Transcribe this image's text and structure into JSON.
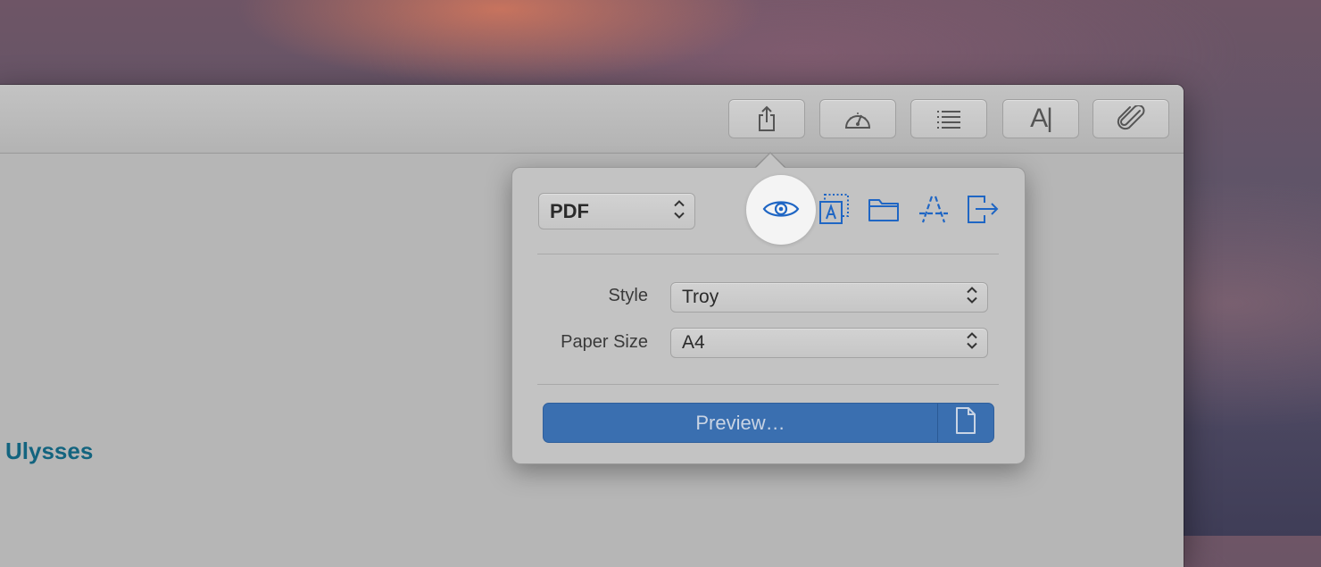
{
  "colors": {
    "accent": "#1f66c4",
    "doc_title": "#13647f",
    "primary_button": "#3a6fb0"
  },
  "toolbar": {
    "buttons": [
      {
        "name": "share",
        "icon": "share-icon"
      },
      {
        "name": "dashboard",
        "icon": "gauge-icon"
      },
      {
        "name": "outline",
        "icon": "list-icon"
      },
      {
        "name": "typography",
        "icon": "text-cursor-icon",
        "glyph": "A|"
      },
      {
        "name": "attachments",
        "icon": "paperclip-icon"
      }
    ]
  },
  "document": {
    "title": "Ulysses"
  },
  "export_popover": {
    "format": {
      "selected": "PDF"
    },
    "actions": [
      {
        "name": "preview",
        "icon": "eye-icon",
        "active": true
      },
      {
        "name": "text-box",
        "icon": "text-box-icon"
      },
      {
        "name": "save-to-folder",
        "icon": "folder-icon"
      },
      {
        "name": "app-store",
        "icon": "app-store-icon"
      },
      {
        "name": "open-in",
        "icon": "export-icon"
      }
    ],
    "style": {
      "label": "Style",
      "value": "Troy"
    },
    "paper_size": {
      "label": "Paper Size",
      "value": "A4"
    },
    "primary_button": {
      "label": "Preview…",
      "secondary_icon": "document-icon"
    }
  }
}
